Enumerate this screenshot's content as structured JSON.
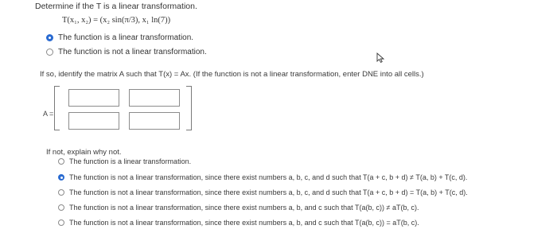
{
  "question": {
    "title": "Determine if the T is a linear transformation.",
    "formula_lhs": "T(x₁, x₂) = ",
    "formula_rhs": "(x₂ sin(π/3), x₁ ln(7))",
    "options": [
      {
        "label": "The function is a linear transformation.",
        "selected": true
      },
      {
        "label": "The function is not a linear transformation.",
        "selected": false
      }
    ]
  },
  "matrix_section": {
    "instruction": "If so, identify the matrix A such that T(x) = Ax. (If the function is not a linear transformation, enter DNE into all cells.)",
    "label": "A =",
    "cells": [
      "",
      "",
      "",
      ""
    ]
  },
  "explain_section": {
    "prompt": "If not, explain why not.",
    "options": [
      {
        "label": "The function is a linear transformation.",
        "selected": false
      },
      {
        "label": "The function is not a linear transformation, since there exist numbers a, b, c, and d such that T(a + c, b + d) ≠ T(a, b) + T(c, d).",
        "selected": true
      },
      {
        "label": "The function is not a linear transformation, since there exist numbers a, b, c, and d such that T(a + c, b + d) = T(a, b) + T(c, d).",
        "selected": false
      },
      {
        "label": "The function is not a linear transformation, since there exist numbers a, b, and c such that T(a(b, c)) ≠ aT(b, c).",
        "selected": false
      },
      {
        "label": "The function is not a linear transformation, since there exist numbers a, b, and c such that T(a(b, c)) = aT(b, c).",
        "selected": false
      }
    ]
  },
  "colors": {
    "accent": "#2a6bd1",
    "text": "#333333",
    "border": "#8c8c8c"
  },
  "icons": {
    "cursor": "mouse-pointer-icon"
  }
}
